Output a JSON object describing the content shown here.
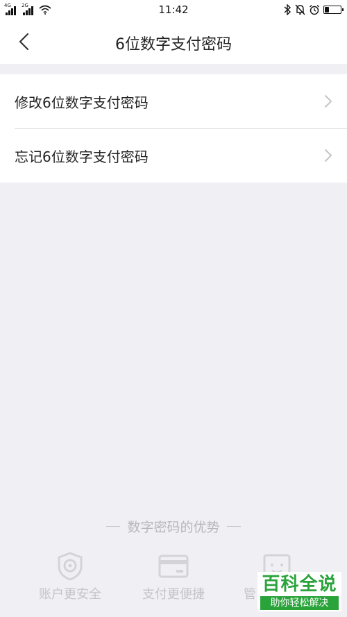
{
  "status_bar": {
    "sim1_network": "4G",
    "sim2_network": "2G",
    "time": "11:42",
    "battery_level": 0.3
  },
  "nav": {
    "title": "6位数字支付密码"
  },
  "menu": {
    "items": [
      {
        "label": "修改6位数字支付密码"
      },
      {
        "label": "忘记6位数字支付密码"
      }
    ]
  },
  "advantages": {
    "title": "数字密码的优势",
    "items": [
      {
        "label": "账户更安全",
        "icon": "shield-icon"
      },
      {
        "label": "支付更便捷",
        "icon": "card-icon"
      },
      {
        "label": "管",
        "icon": "smile-box-icon"
      }
    ]
  },
  "watermark": {
    "main": "百科全说",
    "sub": "助你轻松解决",
    "color": "#2aa33b"
  }
}
